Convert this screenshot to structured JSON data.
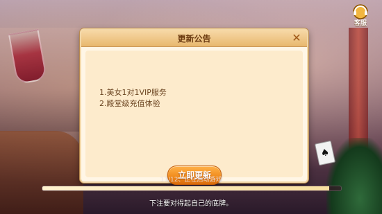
{
  "header": {
    "support_label": "客服"
  },
  "dialog": {
    "title": "更新公告",
    "close_glyph": "✕",
    "lines": [
      "1.美女1对1VIP服务",
      "2.殿堂级充值体验"
    ],
    "update_button": "立即更新"
  },
  "progress": {
    "status_text": "11/12、正在启动游戏",
    "fraction": 0.96
  },
  "footer": {
    "tip": "下注要对得起自己的底牌。"
  },
  "background": {
    "card_glyph": "♠"
  },
  "colors": {
    "accent": "#f08a1a",
    "dialog_bg": "#fff6e6",
    "title_color": "#6b3a10"
  },
  "icons": {
    "support": "headset-icon",
    "close": "close-icon"
  }
}
